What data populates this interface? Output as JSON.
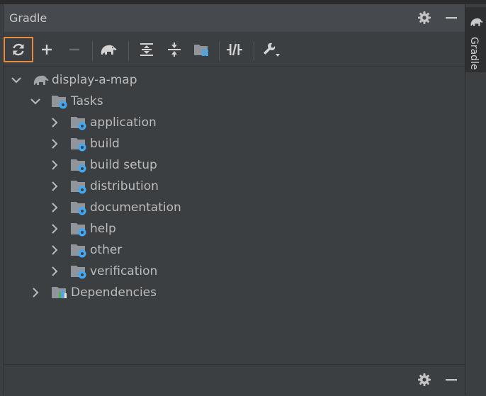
{
  "panel": {
    "title": "Gradle"
  },
  "side_tab": {
    "label": "Gradle"
  },
  "toolbar": {
    "buttons": [
      {
        "icon": "refresh-icon"
      },
      {
        "icon": "plus-icon"
      },
      {
        "icon": "minus-icon"
      },
      {
        "icon": "gradle-elephant-icon"
      },
      {
        "icon": "expand-all-icon"
      },
      {
        "icon": "collapse-all-icon"
      },
      {
        "icon": "module-grid-icon"
      },
      {
        "icon": "toggle-offline-icon"
      },
      {
        "icon": "wrench-icon"
      }
    ]
  },
  "tree": {
    "project": "display-a-map",
    "tasks_label": "Tasks",
    "task_groups": [
      "application",
      "build",
      "build setup",
      "distribution",
      "documentation",
      "help",
      "other",
      "verification"
    ],
    "dependencies_label": "Dependencies"
  },
  "colors": {
    "accent": "#e98c3e",
    "folder": "#8f959b",
    "gear": "#3fa9f5",
    "background": "#3c3f41"
  }
}
